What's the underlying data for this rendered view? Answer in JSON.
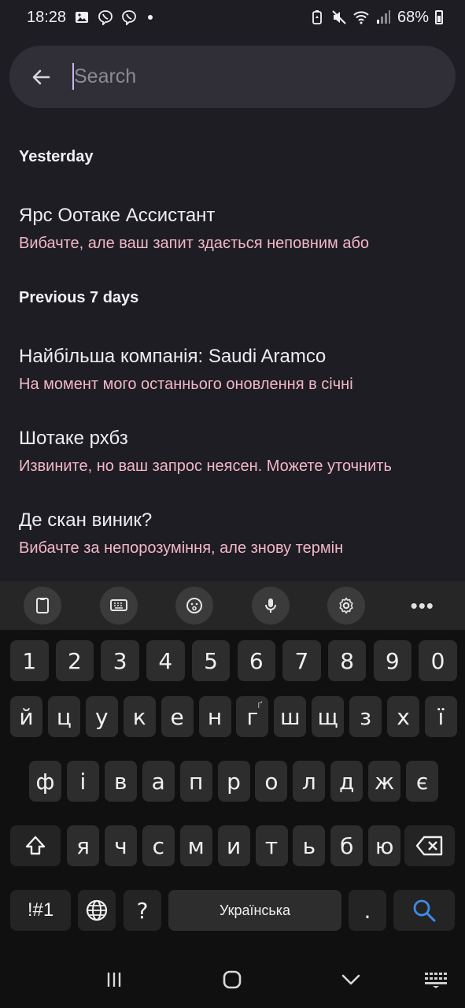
{
  "status_bar": {
    "time": "18:28",
    "battery": "68%"
  },
  "search": {
    "placeholder": "Search",
    "value": ""
  },
  "history": {
    "sections": [
      {
        "header": "Yesterday"
      },
      {
        "header": "Previous 7 days"
      }
    ],
    "items": [
      {
        "title": "Ярс Оотаке Ассистант",
        "subtitle": "Вибачте, але ваш запит здається неповним або"
      },
      {
        "title": "Найбільша компанія: Saudi Aramco",
        "subtitle": "На момент мого останнього оновлення в січні"
      },
      {
        "title": "Шотаке рхбз",
        "subtitle": "Извините, но ваш запрос неясен. Можете уточнить"
      },
      {
        "title": "Де скан виник?",
        "subtitle": "Вибачте за непорозуміння, але знову термін"
      }
    ]
  },
  "keyboard": {
    "toolbar": [
      "clipboard-icon",
      "keyboard-icon",
      "emoji-icon",
      "mic-icon",
      "settings-icon",
      "more-icon"
    ],
    "more_label": "•••",
    "numbers": [
      "1",
      "2",
      "3",
      "4",
      "5",
      "6",
      "7",
      "8",
      "9",
      "0"
    ],
    "row1": [
      "й",
      "ц",
      "у",
      "к",
      "е",
      "н",
      "г",
      "ш",
      "щ",
      "з",
      "х",
      "ї"
    ],
    "row1_hint": "ґ",
    "row2": [
      "ф",
      "і",
      "в",
      "а",
      "п",
      "р",
      "о",
      "л",
      "д",
      "ж",
      "є"
    ],
    "row3": [
      "я",
      "ч",
      "с",
      "м",
      "и",
      "т",
      "ь",
      "б",
      "ю"
    ],
    "symbols_label": "!#1",
    "space_label": "Українська",
    "question": "?",
    "period": "."
  },
  "colors": {
    "background": "#1e1d24",
    "search_bg": "#302f37",
    "subtitle": "#f3b7c6",
    "accent_search": "#3d8ce8"
  }
}
